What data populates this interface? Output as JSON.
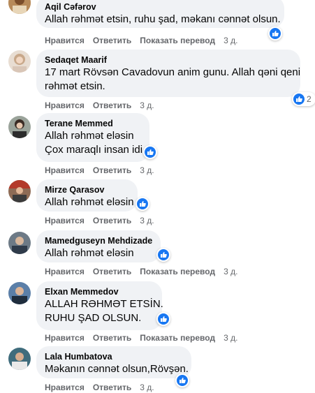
{
  "comments": [
    {
      "name": "Aqil Cəfərov",
      "lines": [
        "Allah rəhmət etsin, ruhu şad, məkanı cənnət olsun."
      ],
      "actions": [
        "Нравится",
        "Ответить",
        "Показать перевод"
      ],
      "time": "3 д.",
      "reactions": ""
    },
    {
      "name": "Sedaqet Maarif",
      "lines": [
        "17 mart Rövsən Cavadovun anim gunu. Allah qəni qeni",
        "rəhmət etsin."
      ],
      "actions": [
        "Нравится",
        "Ответить"
      ],
      "time": "3 д.",
      "reactions": "2"
    },
    {
      "name": "Terane Memmed",
      "lines": [
        "Allah rəhmət eləsin",
        "Çox maraqlı insan idi"
      ],
      "actions": [
        "Нравится",
        "Ответить"
      ],
      "time": "3 д.",
      "reactions": ""
    },
    {
      "name": "Mirze Qarasov",
      "lines": [
        "Allah rəhmət eləsin"
      ],
      "actions": [
        "Нравится",
        "Ответить"
      ],
      "time": "3 д.",
      "reactions": ""
    },
    {
      "name": "Mamedguseyn Mehdizade",
      "lines": [
        "Allah rəhmət eləsin"
      ],
      "actions": [
        "Нравится",
        "Ответить",
        "Показать перевод"
      ],
      "time": "3 д.",
      "reactions": ""
    },
    {
      "name": "Elxan Memmedov",
      "lines": [
        "ALLAH RƏHMƏT ETSİN.",
        "RUHU ŞAD OLSUN."
      ],
      "actions": [
        "Нравится",
        "Ответить",
        "Показать перевод"
      ],
      "time": "3 д.",
      "reactions": ""
    },
    {
      "name": "Lala Humbatova",
      "lines": [
        "Məkanın cənnət olsun,Rövşən."
      ],
      "actions": [
        "Нравится",
        "Ответить"
      ],
      "time": "3 д.",
      "reactions": ""
    }
  ],
  "colors": {
    "bubble": "#f0f2f5",
    "like": "#1877f2",
    "meta": "#65676b",
    "text": "#050505"
  }
}
